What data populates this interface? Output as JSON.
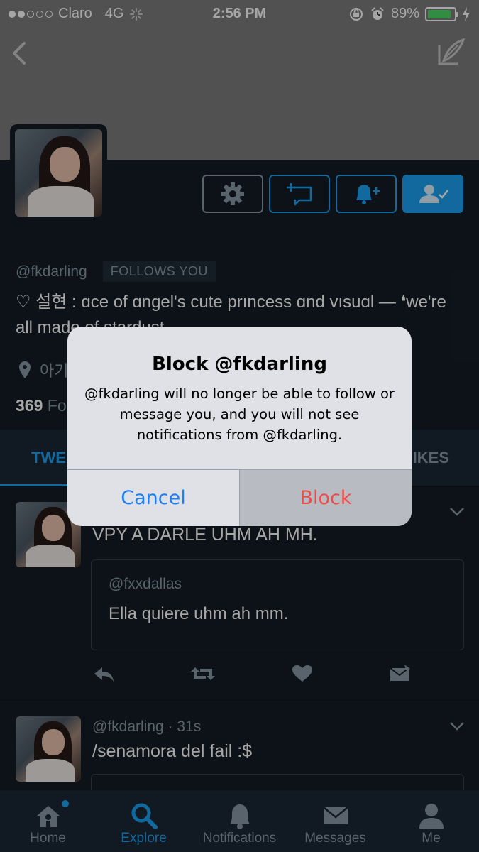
{
  "status_bar": {
    "carrier": "Claro",
    "network": "4G",
    "time": "2:56 PM",
    "battery_percent": "89%",
    "battery_level": 0.89
  },
  "profile": {
    "handle": "@fkdarling",
    "follows_badge": "FOLLOWS YOU",
    "bio": "♡ 설현 : ɑce of ɑngel's cute prıncess ɑnd vısuɑl — ❛we're all made of stardust",
    "location": "아기",
    "following_count": "369",
    "following_label": "Fo"
  },
  "tabs": {
    "tweets": "TWE",
    "likes": "IKES"
  },
  "tweets": [
    {
      "text": "VPY A DARLE UHM AH MH.",
      "quote_handle": "@fxxdallas",
      "quote_text": "Ella quiere uhm ah mm."
    },
    {
      "header": "@fkdarling · 31s",
      "text": "/senamora del fail :$"
    }
  ],
  "bottom_nav": {
    "home": "Home",
    "explore": "Explore",
    "notifications": "Notifications",
    "messages": "Messages",
    "me": "Me"
  },
  "dialog": {
    "title": "Block @fkdarling",
    "message": "@fkdarling will no longer be able to follow or message you, and you will not see notifications from @fkdarling.",
    "cancel_label": "Cancel",
    "block_label": "Block"
  },
  "colors": {
    "accent": "#1da1f2",
    "destructive": "#ee4b4b",
    "ios_blue": "#1f7ff2"
  }
}
